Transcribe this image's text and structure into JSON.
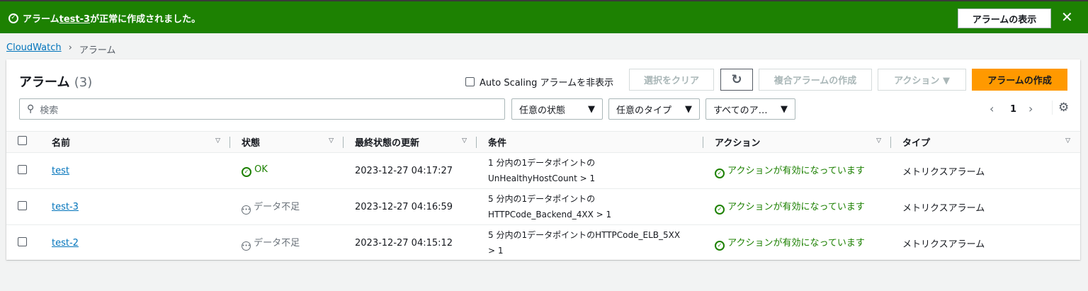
{
  "banner": {
    "prefix": "アラーム",
    "alarm_name": "test-3",
    "suffix": "が正常に作成されました。",
    "view_button": "アラームの表示",
    "close": "✕"
  },
  "breadcrumb": {
    "root": "CloudWatch",
    "separator": "›",
    "current": "アラーム"
  },
  "header": {
    "title": "アラーム",
    "count": "(3)",
    "hide_autoscaling": "Auto Scaling アラームを非表示",
    "clear_selection": "選択をクリア",
    "refresh": "↻",
    "create_composite": "複合アラームの作成",
    "actions": "アクション ▼",
    "create_alarm": "アラームの作成"
  },
  "filters": {
    "search_placeholder": "検索",
    "state": "任意の状態",
    "type": "任意のタイプ",
    "actions": "すべてのア…",
    "page": "1"
  },
  "columns": [
    "名前",
    "状態",
    "最終状態の更新",
    "条件",
    "アクション",
    "タイプ"
  ],
  "rows": [
    {
      "name": "test",
      "state": "OK",
      "state_kind": "ok",
      "updated": "2023-12-27 04:17:27",
      "cond1": "1 分内の1データポイントの",
      "cond2": "UnHealthyHostCount > 1",
      "action": "アクションが有効になっています",
      "type": "メトリクスアラーム"
    },
    {
      "name": "test-3",
      "state": "データ不足",
      "state_kind": "insufficient",
      "updated": "2023-12-27 04:16:59",
      "cond1": "5 分内の1データポイントの",
      "cond2": "HTTPCode_Backend_4XX > 1",
      "action": "アクションが有効になっています",
      "type": "メトリクスアラーム"
    },
    {
      "name": "test-2",
      "state": "データ不足",
      "state_kind": "insufficient",
      "updated": "2023-12-27 04:15:12",
      "cond1": "5 分内の1データポイントのHTTPCode_ELB_5XX",
      "cond2": "> 1",
      "action": "アクションが有効になっています",
      "type": "メトリクスアラーム"
    }
  ]
}
